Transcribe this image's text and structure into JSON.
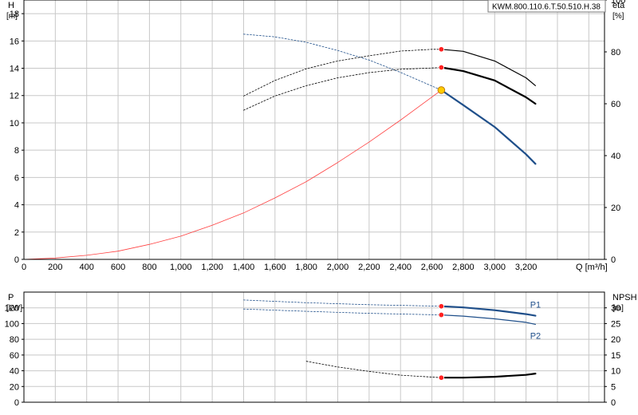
{
  "product_label": "KWM.800.110.6.T.50.510.H.38",
  "chart_data": [
    {
      "type": "line",
      "panel": "head",
      "ylabel": "H",
      "yunit": "[m]",
      "y2label": "eta",
      "y2unit": "[%]",
      "xlabel": "Q [m³/h]",
      "xlim": [
        0,
        3700
      ],
      "ylim": [
        0,
        19
      ],
      "y2lim": [
        0,
        100
      ],
      "grid": true,
      "x_ticks": [
        {
          "v": 0,
          "label": "0"
        },
        {
          "v": 200,
          "label": "200"
        },
        {
          "v": 400,
          "label": "400"
        },
        {
          "v": 600,
          "label": "600"
        },
        {
          "v": 800,
          "label": "800"
        },
        {
          "v": 1000,
          "label": "1,000"
        },
        {
          "v": 1200,
          "label": "1,200"
        },
        {
          "v": 1400,
          "label": "1,400"
        },
        {
          "v": 1600,
          "label": "1,600"
        },
        {
          "v": 1800,
          "label": "1,800"
        },
        {
          "v": 2000,
          "label": "2,000"
        },
        {
          "v": 2200,
          "label": "2,200"
        },
        {
          "v": 2400,
          "label": "2,400"
        },
        {
          "v": 2600,
          "label": "2,600"
        },
        {
          "v": 2800,
          "label": "2,800"
        },
        {
          "v": 3000,
          "label": "3,000"
        },
        {
          "v": 3200,
          "label": "3,200"
        }
      ],
      "y_ticks": [
        {
          "v": 0,
          "label": "0"
        },
        {
          "v": 2,
          "label": "2"
        },
        {
          "v": 4,
          "label": "4"
        },
        {
          "v": 6,
          "label": "6"
        },
        {
          "v": 8,
          "label": "8"
        },
        {
          "v": 10,
          "label": "10"
        },
        {
          "v": 12,
          "label": "12"
        },
        {
          "v": 14,
          "label": "14"
        },
        {
          "v": 16,
          "label": "16"
        },
        {
          "v": 18,
          "label": "18"
        }
      ],
      "y2_ticks": [
        {
          "v": 0,
          "label": "0"
        },
        {
          "v": 20,
          "label": "20"
        },
        {
          "v": 40,
          "label": "40"
        },
        {
          "v": 60,
          "label": "60"
        },
        {
          "v": 80,
          "label": "80"
        },
        {
          "v": 100,
          "label": "100"
        }
      ],
      "duty_point": {
        "x": 2660,
        "y": 12.4,
        "color": "#ffcc00"
      },
      "series": [
        {
          "axis": "y",
          "color": "#ff4040",
          "style": "solid",
          "width": 0.8,
          "x": [
            0,
            200,
            400,
            600,
            800,
            1000,
            1200,
            1400,
            1600,
            1800,
            2000,
            2200,
            2400,
            2660
          ],
          "y": [
            0,
            0.1,
            0.3,
            0.6,
            1.1,
            1.7,
            2.5,
            3.4,
            4.5,
            5.7,
            7.1,
            8.6,
            10.2,
            12.4
          ]
        },
        {
          "axis": "y",
          "color": "#1f4f8a",
          "style": "dashed",
          "width": 0.8,
          "x": [
            1400,
            1600,
            1800,
            2000,
            2200,
            2400,
            2600,
            2660
          ],
          "y": [
            16.5,
            16.3,
            15.9,
            15.3,
            14.6,
            13.7,
            12.7,
            12.4
          ]
        },
        {
          "axis": "y",
          "color": "#1f4f8a",
          "style": "solid",
          "width": 2.2,
          "x": [
            2660,
            2800,
            3000,
            3200,
            3260
          ],
          "y": [
            12.4,
            11.3,
            9.7,
            7.7,
            7.0
          ]
        },
        {
          "axis": "y2",
          "color": "#000000",
          "style": "dashed",
          "width": 0.8,
          "x": [
            1400,
            1600,
            1800,
            2000,
            2200,
            2400,
            2600,
            2660
          ],
          "y": [
            63,
            69,
            73.5,
            76.5,
            78.5,
            80.3,
            81,
            81
          ]
        },
        {
          "axis": "y2",
          "color": "#000000",
          "style": "solid",
          "width": 1.2,
          "x": [
            2660,
            2800,
            3000,
            3200,
            3260
          ],
          "y": [
            81,
            80.2,
            76.5,
            70,
            67
          ]
        },
        {
          "axis": "y2",
          "color": "#000000",
          "style": "dashed",
          "width": 0.8,
          "x": [
            1400,
            1600,
            1800,
            2000,
            2200,
            2400,
            2600,
            2660
          ],
          "y": [
            57.5,
            63,
            67,
            70,
            72,
            73.3,
            73.8,
            74
          ]
        },
        {
          "axis": "y2",
          "color": "#000000",
          "style": "solid",
          "width": 2.2,
          "x": [
            2660,
            2800,
            3000,
            3200,
            3260
          ],
          "y": [
            74,
            72.6,
            69,
            62.5,
            60
          ]
        }
      ],
      "points": [
        {
          "axis": "y2",
          "x": 2660,
          "y": 81,
          "color": "#ff2020"
        },
        {
          "axis": "y2",
          "x": 2660,
          "y": 74,
          "color": "#ff2020"
        }
      ]
    },
    {
      "type": "line",
      "panel": "power",
      "ylabel": "P",
      "yunit": "[kW]",
      "y2label": "NPSH",
      "y2unit": "[m]",
      "xlim": [
        0,
        3700
      ],
      "ylim": [
        0,
        140
      ],
      "y2lim": [
        0,
        35
      ],
      "grid": true,
      "y_ticks": [
        {
          "v": 0,
          "label": "0"
        },
        {
          "v": 20,
          "label": "20"
        },
        {
          "v": 40,
          "label": "40"
        },
        {
          "v": 60,
          "label": "60"
        },
        {
          "v": 80,
          "label": "80"
        },
        {
          "v": 100,
          "label": "100"
        },
        {
          "v": 120,
          "label": "120"
        }
      ],
      "y2_ticks": [
        {
          "v": 0,
          "label": "0"
        },
        {
          "v": 5,
          "label": "5"
        },
        {
          "v": 10,
          "label": "10"
        },
        {
          "v": 15,
          "label": "15"
        },
        {
          "v": 20,
          "label": "20"
        },
        {
          "v": 25,
          "label": "25"
        },
        {
          "v": 30,
          "label": "30"
        }
      ],
      "series": [
        {
          "axis": "y",
          "color": "#1f4f8a",
          "style": "dashed",
          "width": 0.8,
          "x": [
            1400,
            1800,
            2200,
            2660
          ],
          "y": [
            130,
            126.5,
            124,
            122
          ]
        },
        {
          "axis": "y",
          "color": "#1f4f8a",
          "style": "solid",
          "width": 2.2,
          "name": "P1",
          "x": [
            2660,
            2800,
            3000,
            3200,
            3260
          ],
          "y": [
            122,
            120.5,
            117,
            112,
            110
          ]
        },
        {
          "axis": "y",
          "color": "#1f4f8a",
          "style": "dashed",
          "width": 0.8,
          "x": [
            1400,
            1800,
            2200,
            2660
          ],
          "y": [
            118.5,
            115.5,
            113,
            111
          ]
        },
        {
          "axis": "y",
          "color": "#1f4f8a",
          "style": "solid",
          "width": 1.2,
          "name": "P2",
          "x": [
            2660,
            2800,
            3000,
            3200,
            3260
          ],
          "y": [
            111,
            109.5,
            106,
            101.5,
            99
          ]
        },
        {
          "axis": "y2",
          "color": "#000000",
          "style": "dashed",
          "width": 0.8,
          "x": [
            1800,
            2000,
            2200,
            2400,
            2660
          ],
          "y": [
            13,
            11.2,
            9.8,
            8.6,
            7.8
          ]
        },
        {
          "axis": "y2",
          "color": "#000000",
          "style": "solid",
          "width": 2.2,
          "x": [
            2660,
            2800,
            3000,
            3200,
            3260
          ],
          "y": [
            7.8,
            7.8,
            8.1,
            8.7,
            9.1
          ]
        }
      ],
      "points": [
        {
          "axis": "y",
          "x": 2660,
          "y": 122,
          "color": "#ff2020"
        },
        {
          "axis": "y",
          "x": 2660,
          "y": 111,
          "color": "#ff2020"
        },
        {
          "axis": "y2",
          "x": 2660,
          "y": 7.8,
          "color": "#ff2020"
        }
      ]
    }
  ]
}
